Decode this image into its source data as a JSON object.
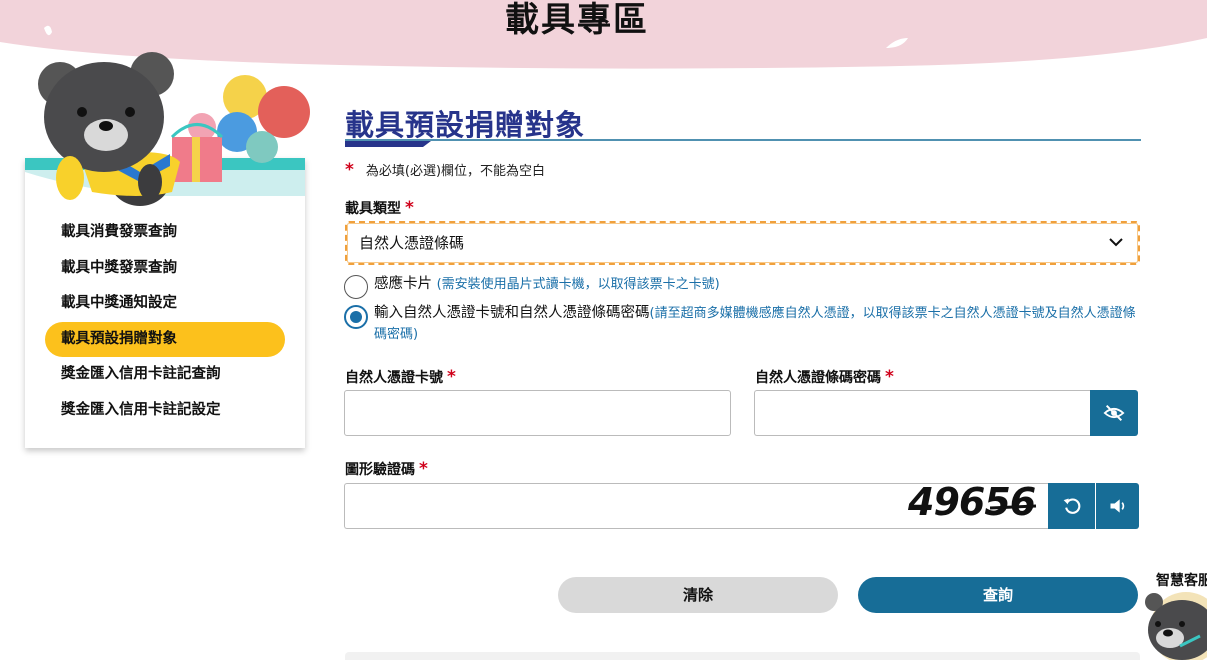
{
  "banner": {
    "title": "載具專區"
  },
  "sidebar": {
    "items": [
      {
        "label": "載具消費發票查詢",
        "active": false
      },
      {
        "label": "載具中獎發票查詢",
        "active": false
      },
      {
        "label": "載具中獎通知設定",
        "active": false
      },
      {
        "label": "載具預設捐贈對象",
        "active": true
      },
      {
        "label": "獎金匯入信用卡註記查詢",
        "active": false
      },
      {
        "label": "獎金匯入信用卡註記設定",
        "active": false
      }
    ]
  },
  "main": {
    "title": "載具預設捐贈對象",
    "required_mark": "*",
    "required_note": "為必填(必選)欄位，不能為空白",
    "carrier_type": {
      "label": "載具類型",
      "selected": "自然人憑證條碼"
    },
    "options": [
      {
        "label": "感應卡片",
        "hint": "(需安裝使用晶片式讀卡機，以取得該票卡之卡號)",
        "checked": false
      },
      {
        "label": "輸入自然人憑證卡號和自然人憑證條碼密碼",
        "hint": "(請至超商多媒體機感應自然人憑證，以取得該票卡之自然人憑證卡號及自然人憑證條碼密碼)",
        "checked": true
      }
    ],
    "card_number": {
      "label": "自然人憑證卡號",
      "value": ""
    },
    "barcode_password": {
      "label": "自然人憑證條碼密碼",
      "value": "",
      "toggle_icon": "eye-slash-icon"
    },
    "captcha": {
      "label": "圖形驗證碼",
      "value": "",
      "image_text": "49656",
      "refresh_icon": "refresh-icon",
      "audio_icon": "speaker-icon"
    },
    "buttons": {
      "clear": "清除",
      "query": "查詢"
    }
  },
  "assistant": {
    "label": "智慧客服"
  },
  "colors": {
    "brand_blue": "#176d97",
    "title_navy": "#27348b",
    "active_yellow": "#fcc11c",
    "banner_pink": "#f2d3da",
    "required_red": "#d0021b"
  }
}
